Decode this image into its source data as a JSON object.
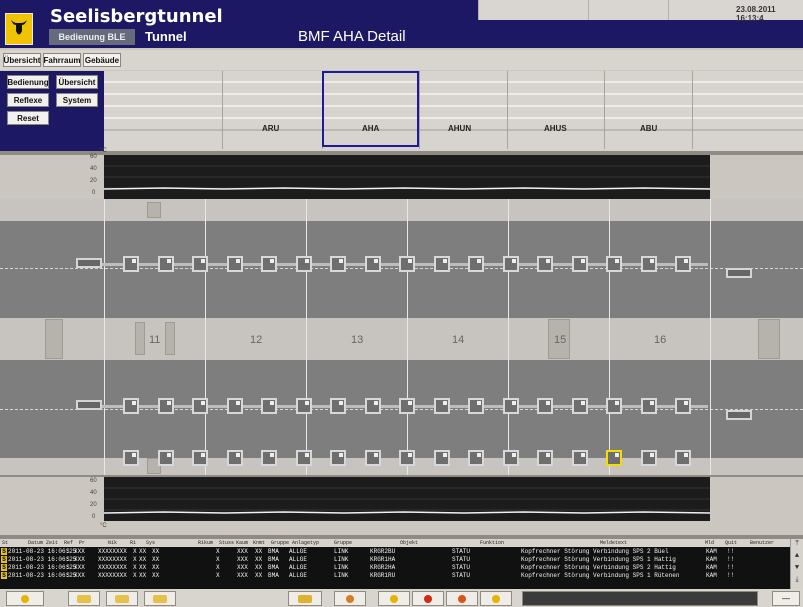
{
  "header": {
    "app_title": "Seelisbergtunnel",
    "mode_button": "Bedienung BLE",
    "subtitle": "Tunnel",
    "page_title": "BMF AHA Detail",
    "datetime": "23.08.2011 16:13:4"
  },
  "nav": {
    "tabs": [
      "Übersicht",
      "Fahrraum",
      "Gebäude"
    ]
  },
  "left_menu": {
    "buttons": [
      "Bedienung",
      "Übersicht",
      "Reflexe",
      "System",
      "Reset"
    ]
  },
  "overview": {
    "sections": [
      "ARU",
      "AHA",
      "AHUN",
      "AHUS",
      "ABU"
    ],
    "selected": "AHA"
  },
  "chart_top": {
    "unit": "°C",
    "ticks": [
      "60",
      "40",
      "20",
      "0"
    ]
  },
  "chart_bottom": {
    "unit": "°C",
    "ticks": [
      "60",
      "40",
      "20",
      "0"
    ]
  },
  "tunnel": {
    "section_numbers": [
      "11",
      "12",
      "13",
      "14",
      "15",
      "16"
    ]
  },
  "alarm_table": {
    "headers": [
      "St",
      "Datum Zeit",
      "Ref",
      "Pr",
      "Nik",
      "Ri",
      "Sys",
      "Rikum",
      "Stuss",
      "Kaum",
      "Knmt",
      "Gruppe",
      "Anlagetyp",
      "Gruppe",
      "Objekt",
      "Funktion",
      "Meldetext",
      "Mld",
      "Quit",
      "Benutzer"
    ],
    "rows": [
      {
        "flag": "S",
        "datetime": "2011-08-23 16:06:25",
        "ref": "S",
        "pr": "XXX",
        "nik": "XXXXXXXX",
        "ri": "X",
        "sys": "XX",
        "rikum": "XX",
        "stuss": "X",
        "kaum": "XXX",
        "knmt": "XX",
        "gruppe": "BMA",
        "anlagetyp": "ALLGE",
        "gruppe2": "LINK",
        "objekt": "KRGR2BU",
        "funktion": "STATU",
        "meldetext": "Kopfrechner Störung Verbindung SPS 2 Büel",
        "mld": "KAM",
        "quit": "!!"
      },
      {
        "flag": "S",
        "datetime": "2011-08-23 16:06:25",
        "ref": "S",
        "pr": "XXX",
        "nik": "XXXXXXXX",
        "ri": "X",
        "sys": "XX",
        "rikum": "XX",
        "stuss": "X",
        "kaum": "XXX",
        "knmt": "XX",
        "gruppe": "BMA",
        "anlagetyp": "ALLGE",
        "gruppe2": "LINK",
        "objekt": "KRGR1HA",
        "funktion": "STATU",
        "meldetext": "Kopfrechner Störung Verbindung SPS 1 Hattig",
        "mld": "KAM",
        "quit": "!!"
      },
      {
        "flag": "S",
        "datetime": "2011-08-23 16:06:25",
        "ref": "S",
        "pr": "XXX",
        "nik": "XXXXXXXX",
        "ri": "X",
        "sys": "XX",
        "rikum": "XX",
        "stuss": "X",
        "kaum": "XXX",
        "knmt": "XX",
        "gruppe": "BMA",
        "anlagetyp": "ALLGE",
        "gruppe2": "LINK",
        "objekt": "KRGR2HA",
        "funktion": "STATU",
        "meldetext": "Kopfrechner Störung Verbindung SPS 2 Hattig",
        "mld": "KAM",
        "quit": "!!"
      },
      {
        "flag": "S",
        "datetime": "2011-08-23 16:06:25",
        "ref": "S",
        "pr": "XXX",
        "nik": "XXXXXXXX",
        "ri": "X",
        "sys": "XX",
        "rikum": "XX",
        "stuss": "X",
        "kaum": "XXX",
        "knmt": "XX",
        "gruppe": "BMA",
        "anlagetyp": "ALLGE",
        "gruppe2": "LINK",
        "objekt": "KRGR1RU",
        "funktion": "STATU",
        "meldetext": "Kopfrechner Störung Verbindung SPS 1 Rütenen",
        "mld": "KAM",
        "quit": "!!"
      }
    ]
  },
  "colors": {
    "header_bg": "#1c1863",
    "accent_yellow": "#f2de00",
    "selection_frame": "#1f1a9a"
  }
}
